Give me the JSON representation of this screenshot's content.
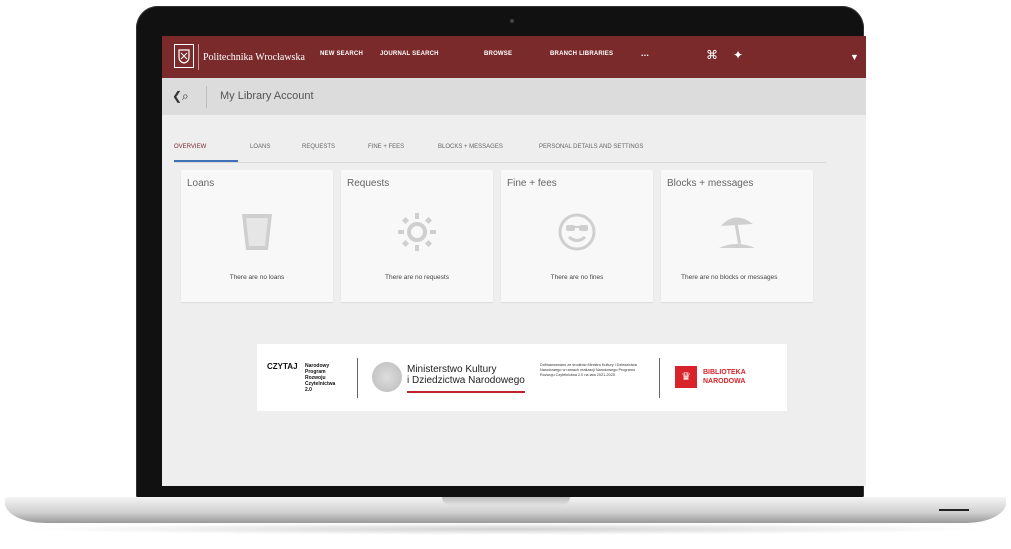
{
  "header": {
    "brand": "Politechnika Wrocławska",
    "nav": [
      "NEW SEARCH",
      "JOURNAL SEARCH",
      "BROWSE",
      "BRANCH LIBRARIES",
      "..."
    ],
    "accent_color": "#7a2a2b"
  },
  "subheader": {
    "page_title": "My Library Account"
  },
  "tabs": [
    "OVERVIEW",
    "LOANS",
    "REQUESTS",
    "FINE + FEES",
    "BLOCKS + MESSAGES",
    "PERSONAL DETAILS AND SETTINGS"
  ],
  "active_tab": "OVERVIEW",
  "cards": [
    {
      "title": "Loans",
      "text": "There are no loans",
      "icon": "glass-icon"
    },
    {
      "title": "Requests",
      "text": "There are no requests",
      "icon": "sun-icon"
    },
    {
      "title": "Fine + fees",
      "text": "There are no fines",
      "icon": "sunglasses-face-icon"
    },
    {
      "title": "Blocks + messages",
      "text": "There are no blocks or messages",
      "icon": "beach-umbrella-icon"
    }
  ],
  "sponsor": {
    "npr_logo": "CZYTAJ",
    "npr_text": "Narodowy\nProgram\nRozwoju\nCzytelnictwa\n2.0",
    "ministry_line1": "Ministerstwo Kultury",
    "ministry_line2": "i Dziedzictwa Narodowego",
    "funding_text": "Dofinansowano ze środków Ministra Kultury i Dziedzictwa Narodowego w ramach realizacji Narodowego Programu Rozwoju Czytelnictwa 2.0 na lata 2021-2025",
    "bn_line1": "BIBLIOTEKA",
    "bn_line2": "NARODOWA"
  }
}
